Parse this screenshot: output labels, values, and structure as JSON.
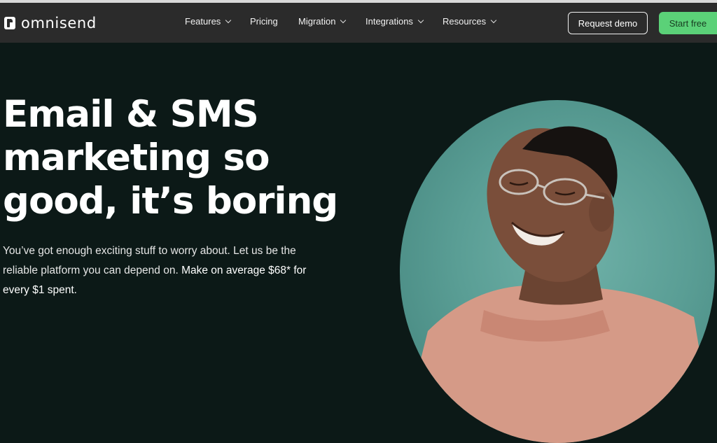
{
  "header": {
    "logo_text": "omnisend",
    "nav": [
      {
        "label": "Features",
        "has_dropdown": true
      },
      {
        "label": "Pricing",
        "has_dropdown": false
      },
      {
        "label": "Migration",
        "has_dropdown": true
      },
      {
        "label": "Integrations",
        "has_dropdown": true
      },
      {
        "label": "Resources",
        "has_dropdown": true
      }
    ],
    "request_demo_label": "Request demo",
    "start_free_label": "Start free"
  },
  "hero": {
    "title_lines": [
      "Email & SMS",
      "marketing so",
      "good, it’s boring"
    ],
    "subtitle": "You’ve got enough exciting stuff to worry about. Let us be the reliable platform you can depend on.",
    "subtitle_highlight": "Make on average $68* for every $1 spent."
  },
  "colors": {
    "page_bg": "#0c1917",
    "nav_bg": "#2b2b2b",
    "accent_green": "#5bd178",
    "circle_teal": "#5a9e95"
  }
}
